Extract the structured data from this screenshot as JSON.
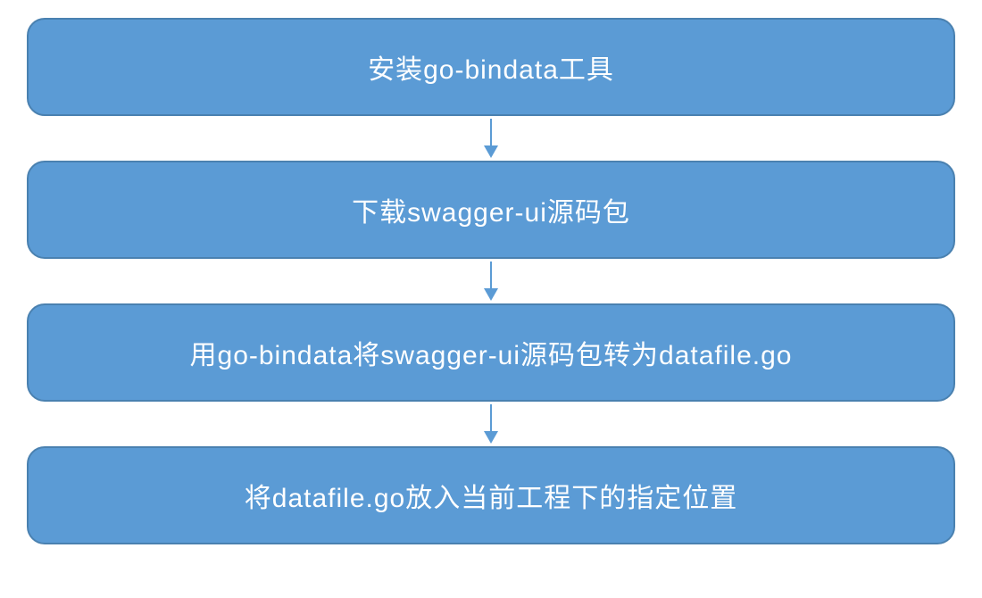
{
  "diagram": {
    "steps": [
      {
        "label": "安装go-bindata工具"
      },
      {
        "label": "下载swagger-ui源码包"
      },
      {
        "label": "用go-bindata将swagger-ui源码包转为datafile.go"
      },
      {
        "label": "将datafile.go放入当前工程下的指定位置"
      }
    ],
    "colors": {
      "box_fill": "#5b9bd5",
      "box_border": "#4a81b0",
      "text": "#ffffff",
      "arrow": "#5b9bd5"
    }
  }
}
